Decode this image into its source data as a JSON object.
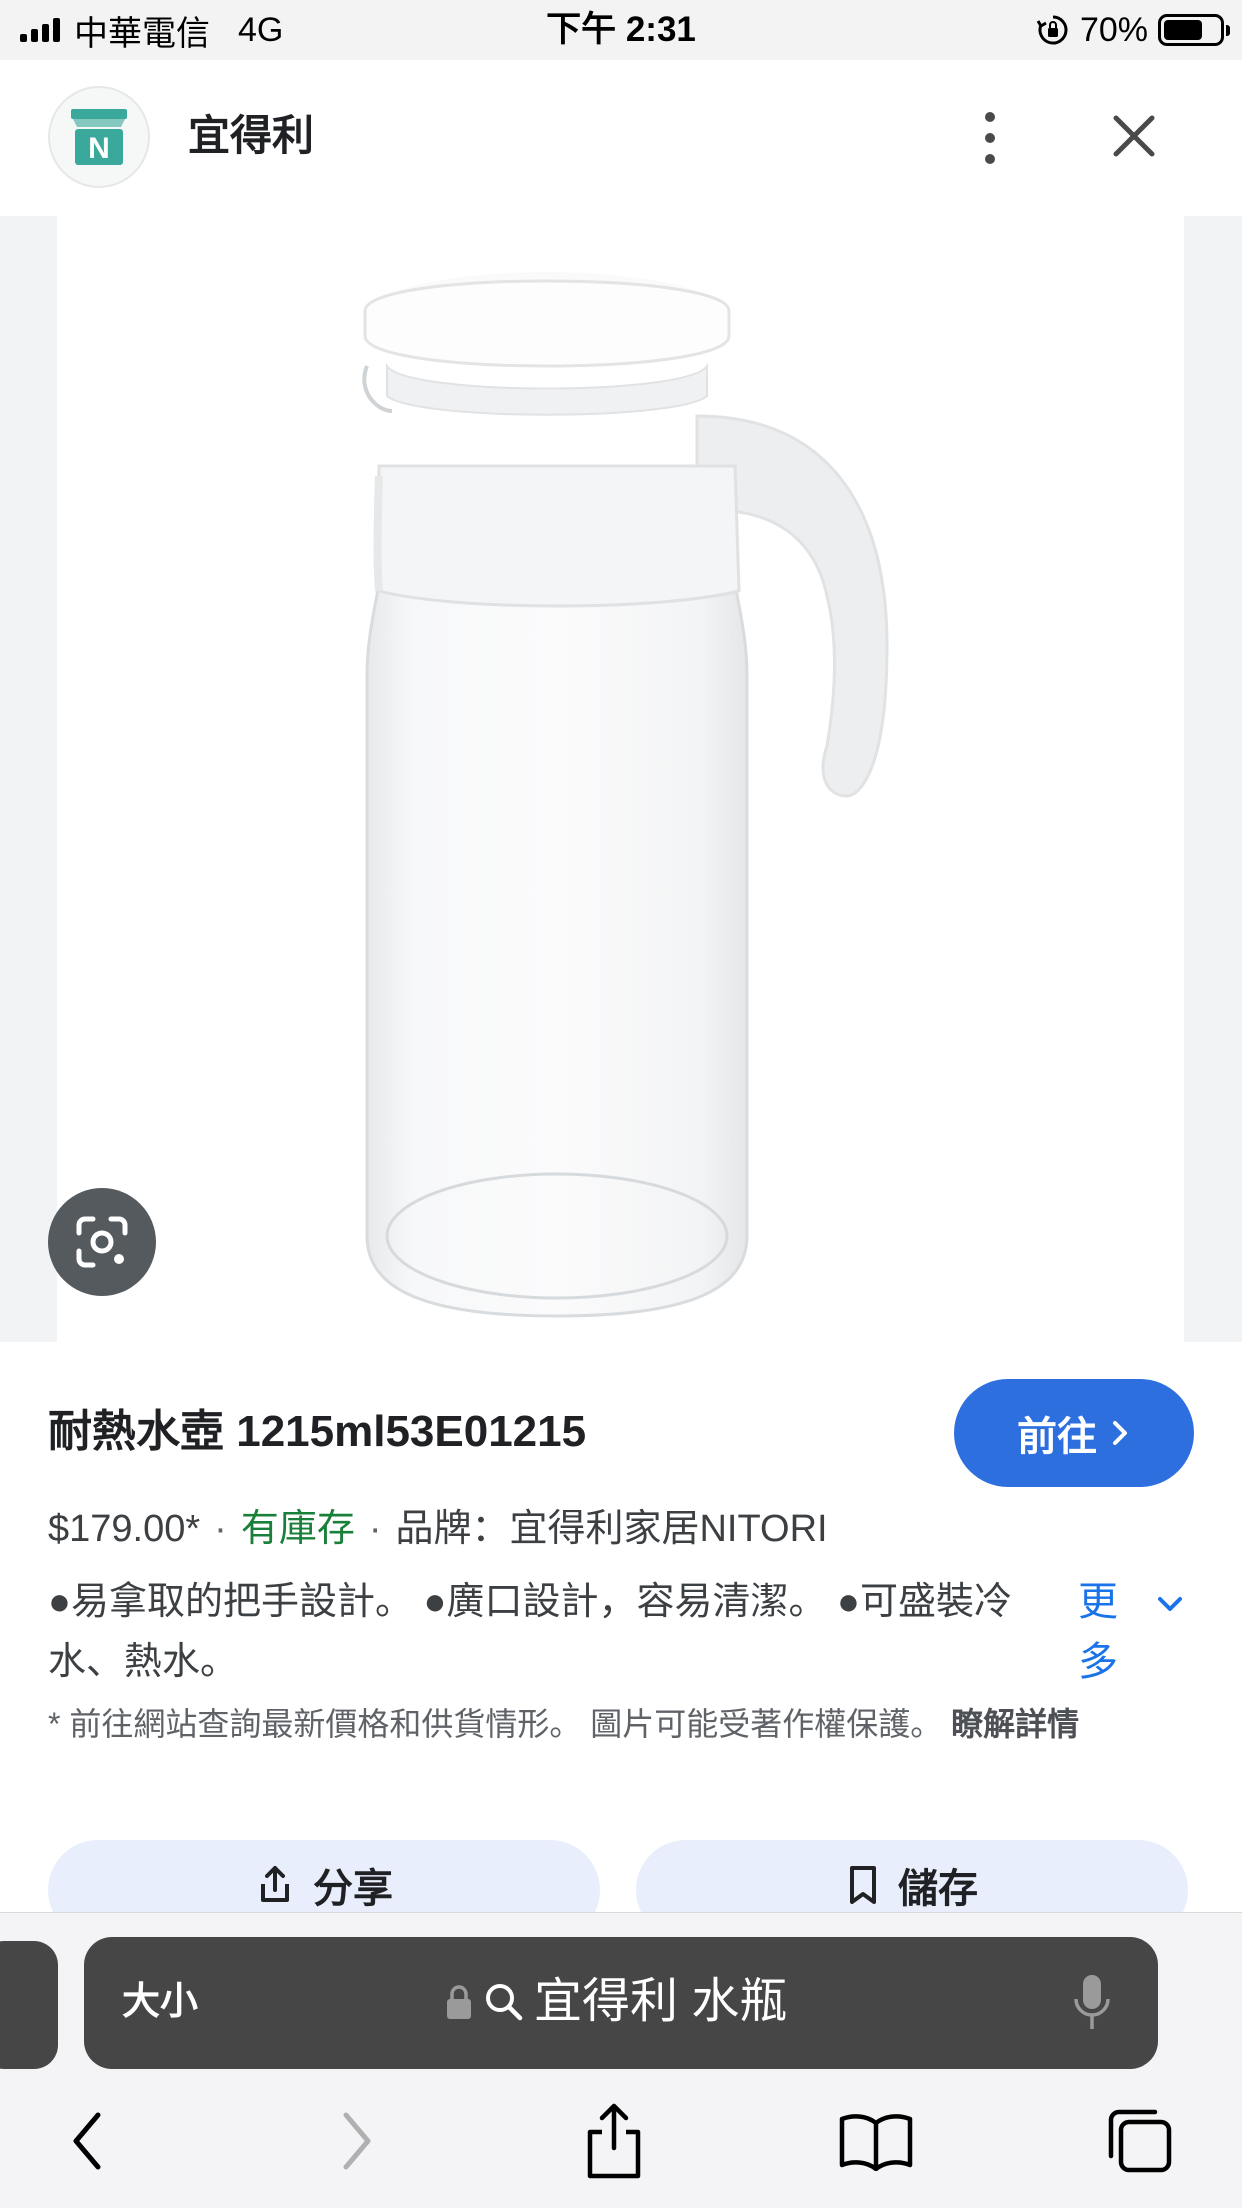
{
  "status_bar": {
    "carrier": "中華電信",
    "network": "4G",
    "time": "下午 2:31",
    "battery_percent": "70%",
    "battery_level": 0.7
  },
  "header": {
    "site_name": "宜得利",
    "logo_letter": "N",
    "logo_color": "#3aa89a"
  },
  "product": {
    "title": "耐熱水壺 1215ml53E01215",
    "visit_label": "前往",
    "price": "$179.00*",
    "stock": "有庫存",
    "brand": "品牌：宜得利家居NITORI",
    "description": "●易拿取的把手設計。 ●廣口設計，容易清潔。 ●可盛裝冷水、熱水。",
    "more_label": "更多",
    "note_text": "* 前往網站查詢最新價格和供貨情形。 圖片可能受著作權保護。",
    "note_link": "瞭解詳情"
  },
  "actions": {
    "share_label": "分享",
    "save_label": "儲存"
  },
  "browser": {
    "text_size_label": "大小",
    "address_text": "宜得利 水瓶"
  },
  "colors": {
    "accent": "#2e6fe0",
    "stock_green": "#188038",
    "link_blue": "#1a73e8"
  }
}
